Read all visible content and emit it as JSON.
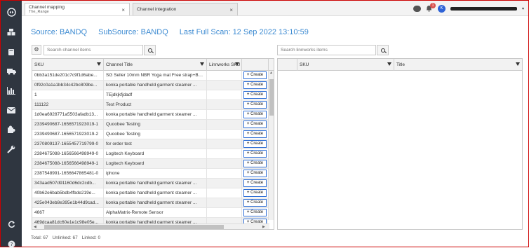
{
  "tabs": [
    {
      "title": "Channel mapping",
      "subtitle": "The_Range",
      "close": "×"
    },
    {
      "title": "Channel integration",
      "subtitle": "",
      "close": "×"
    }
  ],
  "topbar": {
    "notification_count": "1",
    "avatar_initial": "K"
  },
  "header": {
    "source": "Source: BANDQ",
    "subsource": "SubSource: BANDQ",
    "last_scan": "Last Full Scan: 12 Sep 2022 13:10:59"
  },
  "left_search": {
    "placeholder": "Search channel items"
  },
  "right_search": {
    "placeholder": "Search linnworks items"
  },
  "left_columns": [
    "SKU",
    "Channel Title",
    "Linnworks SKU",
    ""
  ],
  "right_columns": [
    "SKU",
    "Title"
  ],
  "create_label": "Create",
  "rows": [
    {
      "sku": "0bb3a151de201c7c9f1d6abe...",
      "title": "SG Seller 10mm NBR Yoga mat Free strap+Bag..."
    },
    {
      "sku": "0f92c0a1a1bb34c42bc809be...",
      "title": "konka portable handheld garment steamer ..."
    },
    {
      "sku": "1",
      "title": "TEjdkjkfjdadf"
    },
    {
      "sku": "111122",
      "title": "Test Product"
    },
    {
      "sku": "1d0ea6928771a5503afadb13...",
      "title": "konka portable handheld garment steamer ..."
    },
    {
      "sku": "2339490687-1656571923019-1",
      "title": "Quoobee Testing"
    },
    {
      "sku": "2339490687-1656571923019-2",
      "title": "Quoobee Testing"
    },
    {
      "sku": "2370809137-1655457719799-0",
      "title": "for order test"
    },
    {
      "sku": "2384675088-1656566498949-0",
      "title": "Logitech Keyboard"
    },
    {
      "sku": "2384675088-1656566498949-1",
      "title": "Logitech Keyboard"
    },
    {
      "sku": "2387548991-1656647865481-0",
      "title": "iphone"
    },
    {
      "sku": "343aad507d91160d6dc2cdb...",
      "title": "konka portable handheld garment steamer ..."
    },
    {
      "sku": "40b62e6bab5bdb4fbde219e...",
      "title": "konka portable handheld garment steamer ..."
    },
    {
      "sku": "425e043eb8e395e1b44d9cad...",
      "title": "konka portable handheld garment steamer ..."
    },
    {
      "sku": "4667",
      "title": "AlphaMatrix-Remote Sensor"
    },
    {
      "sku": "469dcaa81dc60e1e1c98e05e...",
      "title": "konka portable handheld garment steamer ..."
    }
  ],
  "footer": {
    "total": "Total: 67",
    "unlinked": "Unlinked: 67",
    "linked": "Linked: 0"
  },
  "colors": {
    "sidebar": "#2f3640",
    "accent": "#3d8bd2",
    "create_border": "#2f6fd6",
    "frame": "#cc0000"
  }
}
